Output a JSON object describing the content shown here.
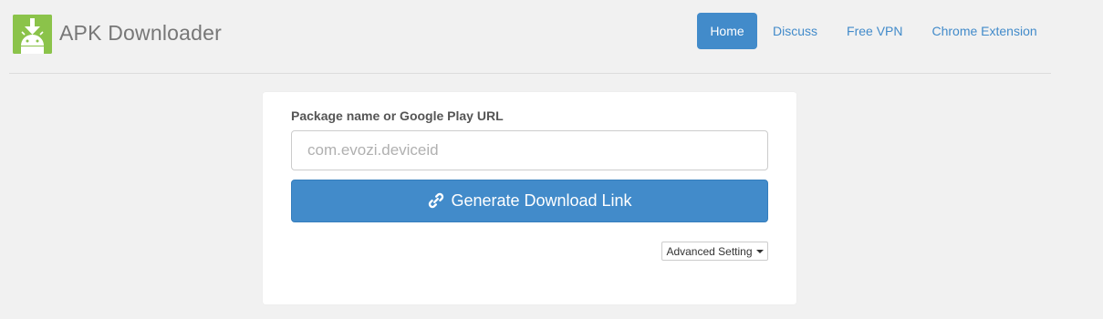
{
  "header": {
    "brand_title": "APK Downloader",
    "logo_icon": "android-download-icon",
    "nav": [
      {
        "label": "Home",
        "active": true
      },
      {
        "label": "Discuss",
        "active": false
      },
      {
        "label": "Free VPN",
        "active": false
      },
      {
        "label": "Chrome Extension",
        "active": false
      }
    ]
  },
  "form": {
    "label": "Package name or Google Play URL",
    "input_value": "",
    "input_placeholder": "com.evozi.deviceid",
    "generate_button_label": "Generate Download Link",
    "generate_button_icon": "link-icon",
    "advanced_button_label": "Advanced Setting",
    "advanced_button_icon": "caret-down-icon"
  },
  "colors": {
    "accent": "#428bca",
    "logo_green": "#8bc34a",
    "background": "#f1f1f1"
  }
}
